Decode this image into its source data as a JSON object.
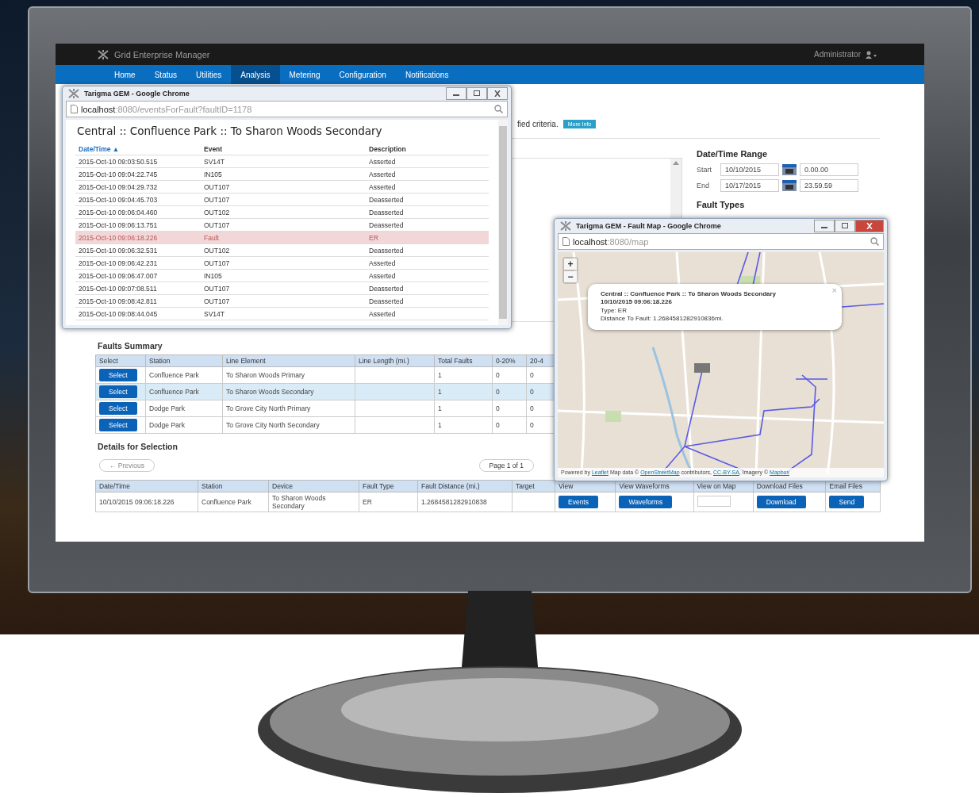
{
  "app": {
    "brand": "Grid Enterprise Manager",
    "user": "Administrator"
  },
  "nav": [
    {
      "label": "Home",
      "selected": false
    },
    {
      "label": "Status",
      "selected": false
    },
    {
      "label": "Utilities",
      "selected": false
    },
    {
      "label": "Analysis",
      "selected": true
    },
    {
      "label": "Metering",
      "selected": false
    },
    {
      "label": "Configuration",
      "selected": false
    },
    {
      "label": "Notifications",
      "selected": false
    }
  ],
  "page": {
    "notice": "fied criteria.",
    "more_info": "More Info",
    "date_range": {
      "title": "Date/Time Range",
      "fields": [
        {
          "label": "Start",
          "date": "10/10/2015",
          "time": "0.00.00"
        },
        {
          "label": "End",
          "date": "10/17/2015",
          "time": "23.59.59"
        }
      ]
    },
    "fault_types_title": "Fault Types"
  },
  "faults_summary": {
    "title": "Faults Summary",
    "columns": [
      "Select",
      "Station",
      "Line Element",
      "Line Length (mi.)",
      "Total Faults",
      "0-20%",
      "20-4"
    ],
    "rows": [
      {
        "selected": false,
        "button": "Select",
        "station": "Confluence Park",
        "line_element": "To Sharon Woods Primary",
        "total_faults": "1",
        "pct_0_20": "0",
        "pct_20_40": "0"
      },
      {
        "selected": true,
        "button": "Select",
        "station": "Confluence Park",
        "line_element": "To Sharon Woods Secondary",
        "total_faults": "1",
        "pct_0_20": "0",
        "pct_20_40": "0"
      },
      {
        "selected": false,
        "button": "Select",
        "station": "Dodge Park",
        "line_element": "To Grove City North Primary",
        "total_faults": "1",
        "pct_0_20": "0",
        "pct_20_40": "0"
      },
      {
        "selected": false,
        "button": "Select",
        "station": "Dodge Park",
        "line_element": "To Grove City North Secondary",
        "total_faults": "1",
        "pct_0_20": "0",
        "pct_20_40": "0"
      }
    ]
  },
  "details": {
    "title": "Details for Selection",
    "previous": "← Previous",
    "page": "Page 1 of 1",
    "columns": [
      "Date/Time",
      "Station",
      "Device",
      "Fault Type",
      "Fault Distance (mi.)",
      "Target",
      "View",
      "View Waveforms",
      "View on Map",
      "Download Files",
      "Email Files"
    ],
    "rows": [
      {
        "date_time": "10/10/2015 09:06:18.226",
        "station": "Confluence Park",
        "device": "To Sharon Woods Secondary",
        "fault_type": "ER",
        "distance": "1.2684581282910838",
        "events": "Events",
        "waveforms": "Waveforms",
        "download": "Download",
        "send": "Send"
      }
    ]
  },
  "events_window": {
    "title": "Tarigma GEM - Google Chrome",
    "url_host": "localhost",
    "url_path": ":8080/eventsForFault?faultID=1178",
    "heading": "Central :: Confluence Park :: To Sharon Woods Secondary",
    "columns": [
      "Date/Time ▲",
      "Event",
      "Description"
    ],
    "rows": [
      {
        "time": "2015-Oct-10 09:03:50.515",
        "event": "SV14T",
        "description": "Asserted",
        "fault": false
      },
      {
        "time": "2015-Oct-10 09:04:22.745",
        "event": "IN105",
        "description": "Asserted",
        "fault": false
      },
      {
        "time": "2015-Oct-10 09:04:29.732",
        "event": "OUT107",
        "description": "Asserted",
        "fault": false
      },
      {
        "time": "2015-Oct-10 09:04:45.703",
        "event": "OUT107",
        "description": "Deasserted",
        "fault": false
      },
      {
        "time": "2015-Oct-10 09:06:04.460",
        "event": "OUT102",
        "description": "Deasserted",
        "fault": false
      },
      {
        "time": "2015-Oct-10 09:06:13.751",
        "event": "OUT107",
        "description": "Deasserted",
        "fault": false
      },
      {
        "time": "2015-Oct-10 09:06:18.226",
        "event": "Fault",
        "description": "ER",
        "fault": true
      },
      {
        "time": "2015-Oct-10 09:06:32.531",
        "event": "OUT102",
        "description": "Deasserted",
        "fault": false
      },
      {
        "time": "2015-Oct-10 09:06:42.231",
        "event": "OUT107",
        "description": "Asserted",
        "fault": false
      },
      {
        "time": "2015-Oct-10 09:06:47.007",
        "event": "IN105",
        "description": "Asserted",
        "fault": false
      },
      {
        "time": "2015-Oct-10 09:07:08.511",
        "event": "OUT107",
        "description": "Deasserted",
        "fault": false
      },
      {
        "time": "2015-Oct-10 09:08:42.811",
        "event": "OUT107",
        "description": "Deasserted",
        "fault": false
      },
      {
        "time": "2015-Oct-10 09:08:44.045",
        "event": "SV14T",
        "description": "Asserted",
        "fault": false
      }
    ]
  },
  "map_window": {
    "title": "Tarigma GEM - Fault Map - Google Chrome",
    "url_host": "localhost",
    "url_path": ":8080/map",
    "zoom_in": "+",
    "zoom_out": "−",
    "popup": {
      "close": "×",
      "heading": "Central :: Confluence Park :: To Sharon Woods Secondary",
      "time": "10/10/2015 09:06:18.226",
      "type": "Type: ER",
      "distance": "Distance To Fault: 1.2684581282910836mi."
    },
    "attribution": {
      "prefix": "Powered by",
      "leaflet": "Leaflet",
      "data": "Map data ©",
      "osm": "OpenStreetMap",
      "contributors": "contributors,",
      "license": "CC-BY-SA",
      "imagery": ", Imagery ©",
      "mapbox": "Mapbox"
    }
  }
}
